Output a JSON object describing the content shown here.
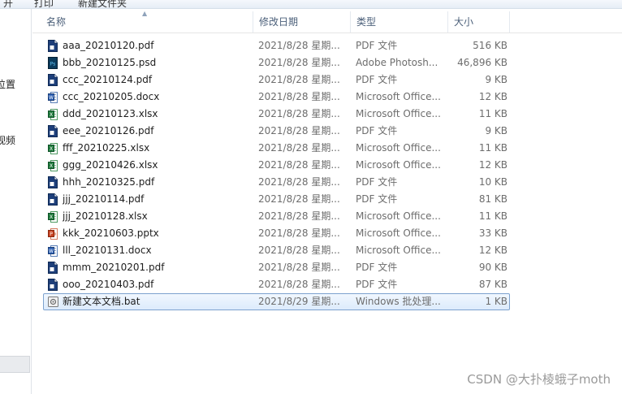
{
  "toolbar": {
    "items": [
      "开",
      "打印",
      "新建文件夹"
    ]
  },
  "nav": {
    "items": [
      "位置",
      "视频"
    ]
  },
  "columns": {
    "name": "名称",
    "date": "修改日期",
    "type": "类型",
    "size": "大小"
  },
  "files": [
    {
      "name": "aaa_20210120.pdf",
      "date": "2021/8/28 星期...",
      "type": "PDF 文件",
      "size": "516 KB",
      "icon": "pdf-icon"
    },
    {
      "name": "bbb_20210125.psd",
      "date": "2021/8/28 星期...",
      "type": "Adobe Photosh...",
      "size": "46,896 KB",
      "icon": "psd-icon"
    },
    {
      "name": "ccc_20210124.pdf",
      "date": "2021/8/28 星期...",
      "type": "PDF 文件",
      "size": "9 KB",
      "icon": "pdf-icon"
    },
    {
      "name": "ccc_20210205.docx",
      "date": "2021/8/28 星期...",
      "type": "Microsoft Office...",
      "size": "12 KB",
      "icon": "docx-icon"
    },
    {
      "name": "ddd_20210123.xlsx",
      "date": "2021/8/28 星期...",
      "type": "Microsoft Office...",
      "size": "11 KB",
      "icon": "xlsx-icon"
    },
    {
      "name": "eee_20210126.pdf",
      "date": "2021/8/28 星期...",
      "type": "PDF 文件",
      "size": "9 KB",
      "icon": "pdf-icon"
    },
    {
      "name": "fff_20210225.xlsx",
      "date": "2021/8/28 星期...",
      "type": "Microsoft Office...",
      "size": "11 KB",
      "icon": "xlsx-icon"
    },
    {
      "name": "ggg_20210426.xlsx",
      "date": "2021/8/28 星期...",
      "type": "Microsoft Office...",
      "size": "12 KB",
      "icon": "xlsx-icon"
    },
    {
      "name": "hhh_20210325.pdf",
      "date": "2021/8/28 星期...",
      "type": "PDF 文件",
      "size": "10 KB",
      "icon": "pdf-icon"
    },
    {
      "name": "jjj_20210114.pdf",
      "date": "2021/8/28 星期...",
      "type": "PDF 文件",
      "size": "81 KB",
      "icon": "pdf-icon"
    },
    {
      "name": "jjj_20210128.xlsx",
      "date": "2021/8/28 星期...",
      "type": "Microsoft Office...",
      "size": "11 KB",
      "icon": "xlsx-icon"
    },
    {
      "name": "kkk_20210603.pptx",
      "date": "2021/8/28 星期...",
      "type": "Microsoft Office...",
      "size": "33 KB",
      "icon": "pptx-icon"
    },
    {
      "name": "lll_20210131.docx",
      "date": "2021/8/28 星期...",
      "type": "Microsoft Office...",
      "size": "12 KB",
      "icon": "docx-icon"
    },
    {
      "name": "mmm_20210201.pdf",
      "date": "2021/8/28 星期...",
      "type": "PDF 文件",
      "size": "90 KB",
      "icon": "pdf-icon"
    },
    {
      "name": "ooo_20210403.pdf",
      "date": "2021/8/28 星期...",
      "type": "PDF 文件",
      "size": "87 KB",
      "icon": "pdf-icon"
    },
    {
      "name": "新建文本文档.bat",
      "date": "2021/8/29 星期...",
      "type": "Windows 批处理...",
      "size": "1 KB",
      "icon": "bat-icon",
      "selected": true
    }
  ],
  "watermark": "CSDN @大扑棱蛾子moth",
  "colors": {
    "pdf": "#1e3f7a",
    "psd": "#0b3b5c",
    "docx": "#2b5fb4",
    "xlsx": "#1f7a3c",
    "pptx": "#c8401f",
    "selection_border": "#7da2ce"
  }
}
